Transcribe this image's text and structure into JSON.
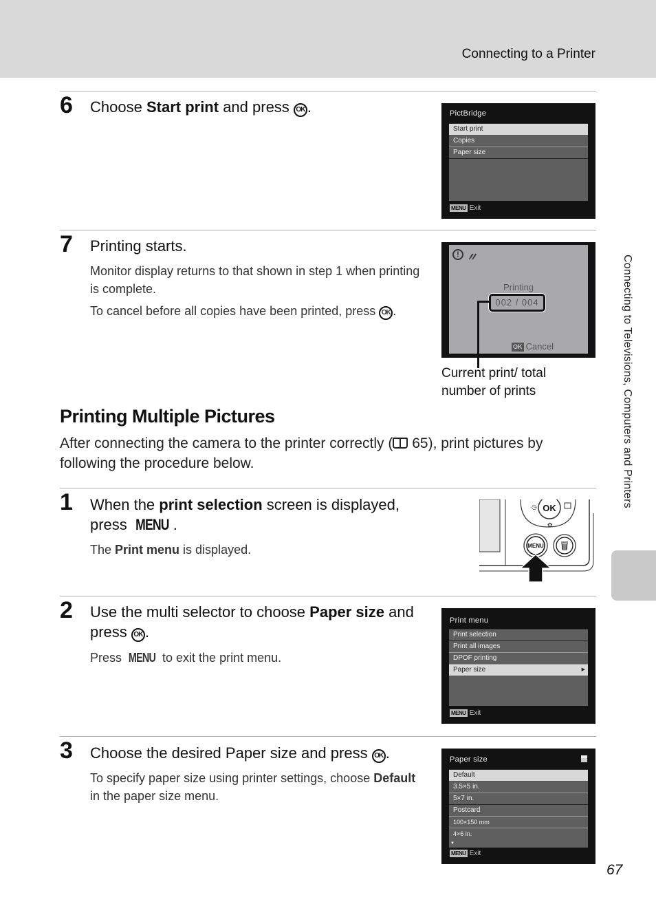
{
  "header": {
    "title": "Connecting to a Printer"
  },
  "side_tab": {
    "label": "Connecting to Televisions, Computers and Printers"
  },
  "page_number": "67",
  "steps_top": [
    {
      "number": "6",
      "title_parts": [
        "Choose ",
        "Start print",
        " and press ",
        "OK",
        "."
      ],
      "screen": {
        "title": "PictBridge",
        "items": [
          "Start print",
          "Copies",
          "Paper size"
        ],
        "selected_index": 0,
        "footer_key": "MENU",
        "footer_label": "Exit"
      }
    },
    {
      "number": "7",
      "title": "Printing starts.",
      "body_1": "Monitor display returns to that shown in step 1 when printing is complete.",
      "body_2_text": "To cancel before all copies have been printed, press ",
      "body_2_key": "OK",
      "screen": {
        "status_label": "Printing",
        "counter": "002 / 004",
        "current_print": 2,
        "total_prints": 4,
        "cancel_key": "OK",
        "cancel_label": "Cancel"
      },
      "callout": "Current print/ total number of prints"
    }
  ],
  "section": {
    "title": "Printing Multiple Pictures",
    "intro_before": "After connecting the camera to the printer correctly (",
    "intro_ref": "65",
    "intro_after": "), print pictures by following the procedure below."
  },
  "steps_bottom": [
    {
      "number": "1",
      "title_parts": [
        "When the ",
        "print selection",
        " screen is displayed, press ",
        "MENU",
        "."
      ],
      "body_parts": [
        "The ",
        "Print menu",
        " is displayed."
      ],
      "illustration": {
        "ok_label": "OK",
        "menu_label": "MENU"
      }
    },
    {
      "number": "2",
      "title_parts": [
        "Use the multi selector to choose ",
        "Paper size",
        " and press ",
        "OK",
        "."
      ],
      "body_parts": [
        "Press ",
        "MENU",
        " to exit the print menu."
      ],
      "screen": {
        "title": "Print menu",
        "items": [
          "Print selection",
          "Print all images",
          "DPOF printing",
          "Paper size"
        ],
        "selected_index": 3,
        "footer_key": "MENU",
        "footer_label": "Exit"
      }
    },
    {
      "number": "3",
      "title_parts": [
        "Choose the desired Paper size and press ",
        "OK",
        "."
      ],
      "body_parts": [
        "To specify paper size using printer settings, choose ",
        "Default",
        " in the paper size menu."
      ],
      "screen": {
        "title": "Paper size",
        "items": [
          "Default",
          "3.5×5 in.",
          "5×7 in.",
          "Postcard",
          "100×150 mm",
          "4×6 in."
        ],
        "selected_index": 0,
        "footer_key": "MENU",
        "footer_label": "Exit"
      }
    }
  ]
}
